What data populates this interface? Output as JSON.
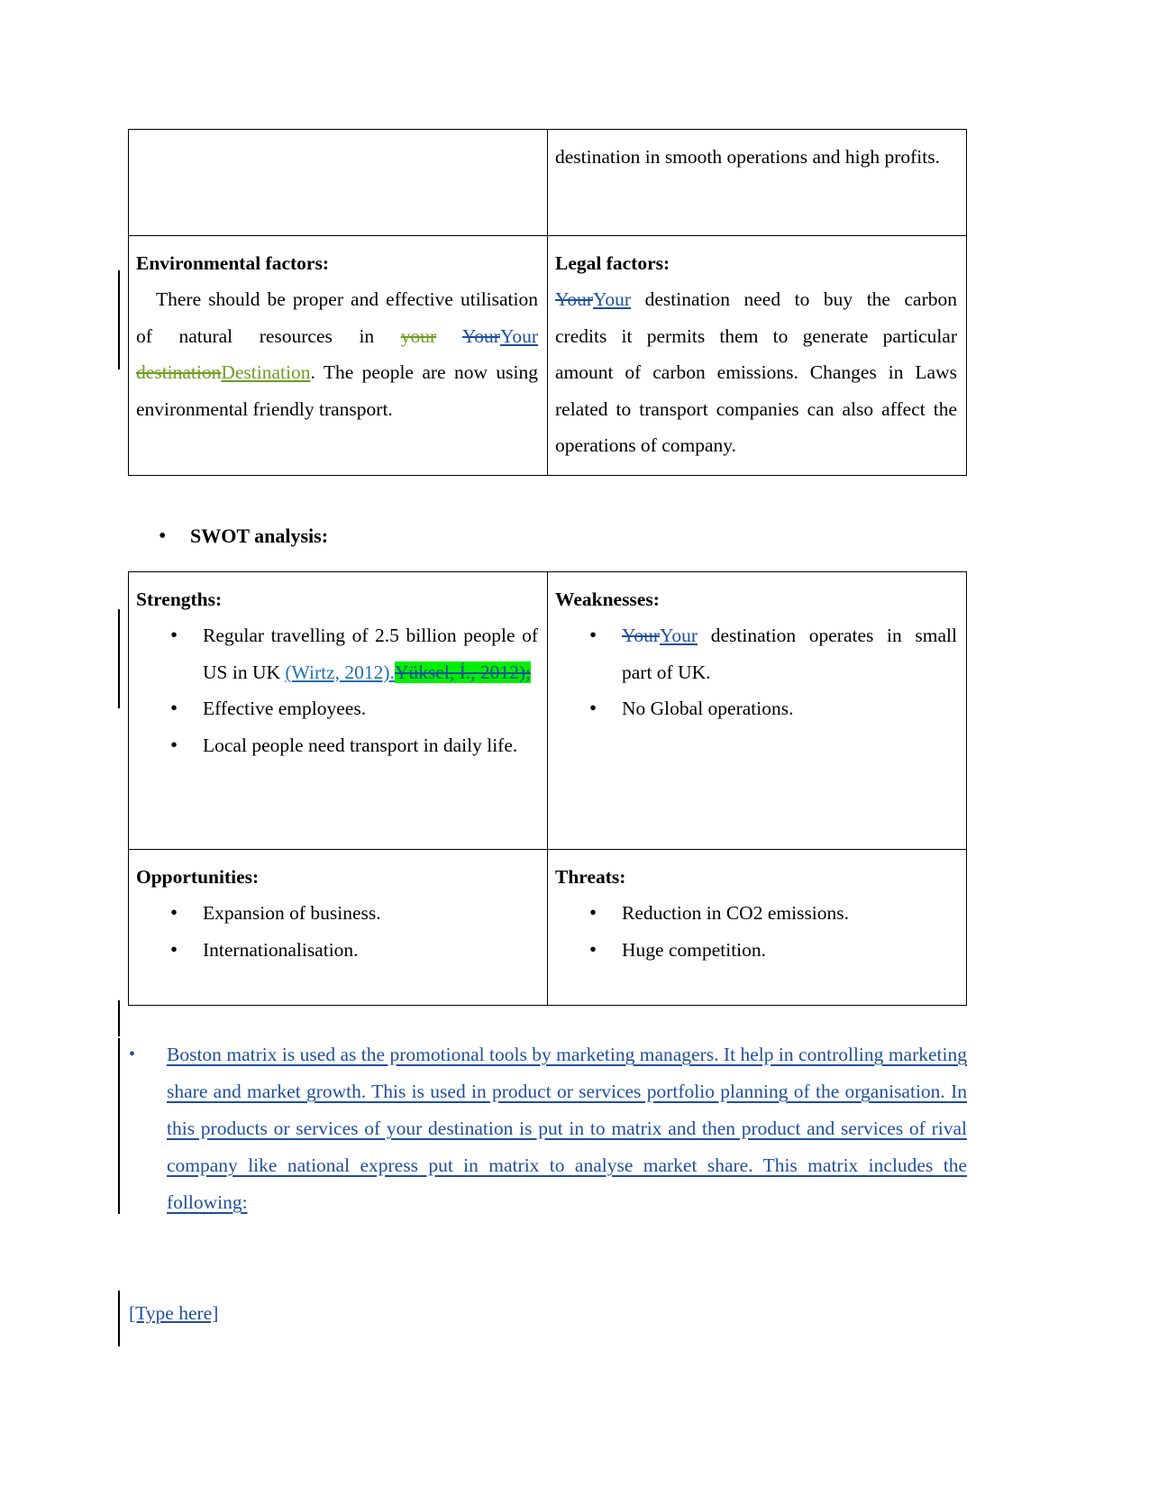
{
  "document": {
    "footer_text": "[Type here]",
    "swot_heading": "SWOT analysis:",
    "bullet_glyph": "•"
  },
  "colors": {
    "deletion_blue": "#1f4e9c",
    "insertion_blue": "#1f4e9c",
    "deletion_green": "#6f9c1f",
    "insertion_green": "#6f9c1f",
    "highlight_green": "#00ee00",
    "citation_blue": "#1f6fb5",
    "table_border": "#000000"
  },
  "pestle_table": {
    "continuation_row": {
      "left_cell": "",
      "right_cell": "destination in smooth operations and high profits."
    },
    "environmental_cell": {
      "heading": "Environmental factors:",
      "text_run_1": "There should be proper and effective utilisation of natural resources in ",
      "deleted_your_lower": "your",
      "deleted_your_upper": "Your",
      "inserted_your_upper": "Your",
      "space_run": " ",
      "deleted_destination": "destination",
      "inserted_destination": "Destination",
      "text_run_2": ". The people are now using environmental friendly transport."
    },
    "legal_cell": {
      "heading": "Legal factors:",
      "deleted_your": "Your",
      "inserted_your": "Your",
      "text_run": " destination need to buy the carbon credits it permits them to generate particular amount of carbon emissions. Changes in Laws related to transport companies can also affect the operations of company."
    }
  },
  "swot_table": {
    "strengths": {
      "heading": "Strengths:",
      "items": [
        {
          "prefix": "Regular travelling of 2.5 billion people of US in UK ",
          "citation_inserted": "(Wirtz, 2012).",
          "citation_deleted_highlighted": "Yüksel, İ., 2012);"
        },
        {
          "prefix": "Effective employees."
        },
        {
          "prefix": "Local people need transport in daily life."
        }
      ]
    },
    "weaknesses": {
      "heading": "Weaknesses:",
      "items": [
        {
          "deleted_your": "Your",
          "inserted_your": "Your",
          "text": " destination operates in small part of UK."
        },
        {
          "text": "No Global operations."
        }
      ]
    },
    "opportunities": {
      "heading": "Opportunities:",
      "items": [
        "Expansion of business.",
        "Internationalisation."
      ]
    },
    "threats": {
      "heading": "Threats:",
      "items": [
        "Reduction in CO2 emissions.",
        "Huge competition."
      ]
    }
  },
  "boston_paragraph": {
    "text": "Boston matrix is used as the promotional tools by marketing managers. It help in controlling marketing share and market growth. This is used in product or services portfolio planning of the organisation. In this products or services of your destination is put in to matrix and then product and services of rival company like national express put in matrix to analyse market share. This matrix includes the following:"
  }
}
